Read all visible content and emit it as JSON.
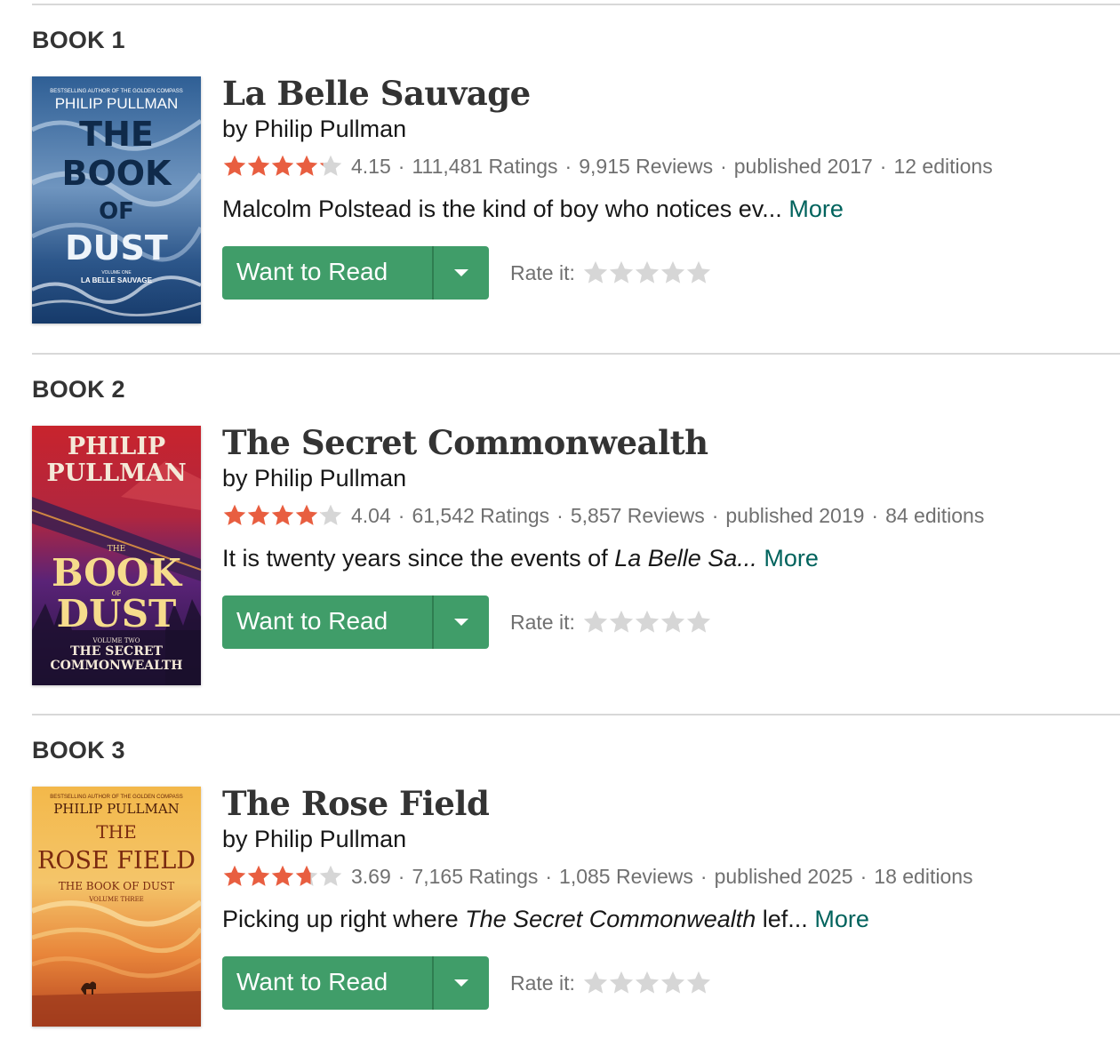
{
  "colors": {
    "accent_green": "#409d69",
    "link_teal": "#00635d",
    "star_orange": "#e85e40",
    "star_empty": "#d6d6d6",
    "meta_gray": "#707070"
  },
  "books": [
    {
      "number": "BOOK 1",
      "title": "La Belle Sauvage",
      "author": "by Philip Pullman",
      "rating": "4.15",
      "rating_value": 4.15,
      "ratings_count": "111,481 Ratings",
      "reviews_count": "9,915 Reviews",
      "published": "published 2017",
      "editions": "12 editions",
      "desc_before": "Malcolm Polstead is the kind of boy who notices ev...",
      "desc_italic": "",
      "desc_after": "",
      "more": "More",
      "want_to_read": "Want to Read",
      "rate_label": "Rate it:",
      "cover": {
        "top_line": "BESTSELLING AUTHOR OF THE GOLDEN COMPASS",
        "author": "PHILIP PULLMAN",
        "title_1": "THE",
        "title_2": "BOOK",
        "title_3": "OF",
        "title_4": "DUST",
        "volume": "VOLUME ONE",
        "subtitle": "LA BELLE SAUVAGE"
      }
    },
    {
      "number": "BOOK 2",
      "title": "The Secret Commonwealth",
      "author": "by Philip Pullman",
      "rating": "4.04",
      "rating_value": 4.04,
      "ratings_count": "61,542 Ratings",
      "reviews_count": "5,857 Reviews",
      "published": "published 2019",
      "editions": "84 editions",
      "desc_before": "It is twenty years since the events of ",
      "desc_italic": "La Belle Sa...",
      "desc_after": "",
      "more": "More",
      "want_to_read": "Want to Read",
      "rate_label": "Rate it:",
      "cover": {
        "author_1": "PHILIP",
        "author_2": "PULLMAN",
        "title_1": "THE",
        "title_2": "BOOK",
        "title_3": "OF",
        "title_4": "DUST",
        "volume": "VOLUME TWO",
        "subtitle_1": "THE SECRET",
        "subtitle_2": "COMMONWEALTH"
      }
    },
    {
      "number": "BOOK 3",
      "title": "The Rose Field",
      "author": "by Philip Pullman",
      "rating": "3.69",
      "rating_value": 3.69,
      "ratings_count": "7,165 Ratings",
      "reviews_count": "1,085 Reviews",
      "published": "published 2025",
      "editions": "18 editions",
      "desc_before": "Picking up right where ",
      "desc_italic": "The Secret Commonwealth",
      "desc_after": " lef...",
      "more": "More",
      "want_to_read": "Want to Read",
      "rate_label": "Rate it:",
      "cover": {
        "top_line": "BESTSELLING AUTHOR OF THE GOLDEN COMPASS",
        "author": "PHILIP PULLMAN",
        "title_1": "THE",
        "title_2": "ROSE FIELD",
        "subtitle": "THE BOOK OF DUST",
        "volume": "VOLUME THREE"
      }
    }
  ]
}
